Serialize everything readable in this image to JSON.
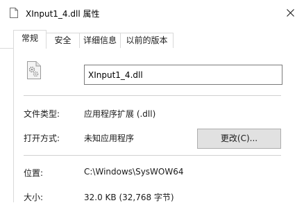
{
  "window": {
    "title": "XInput1_4.dll 属性",
    "app_icon": "document-page-icon",
    "close_icon": "close-icon"
  },
  "tabs": [
    {
      "label": "常规",
      "active": true
    },
    {
      "label": "安全",
      "active": false
    },
    {
      "label": "详细信息",
      "active": false
    },
    {
      "label": "以前的版本",
      "active": false
    }
  ],
  "general": {
    "file_icon": "dll-gear-file-icon",
    "file_name": "XInput1_4.dll",
    "type_label": "文件类型:",
    "type_value": "应用程序扩展 (.dll)",
    "open_with_label": "打开方式:",
    "open_with_value": "未知应用程序",
    "change_button": "更改(C)...",
    "location_label": "位置:",
    "location_value": "C:\\Windows\\SysWOW64",
    "size_label": "大小:",
    "size_value": "32.0 KB (32,768 字节)"
  }
}
